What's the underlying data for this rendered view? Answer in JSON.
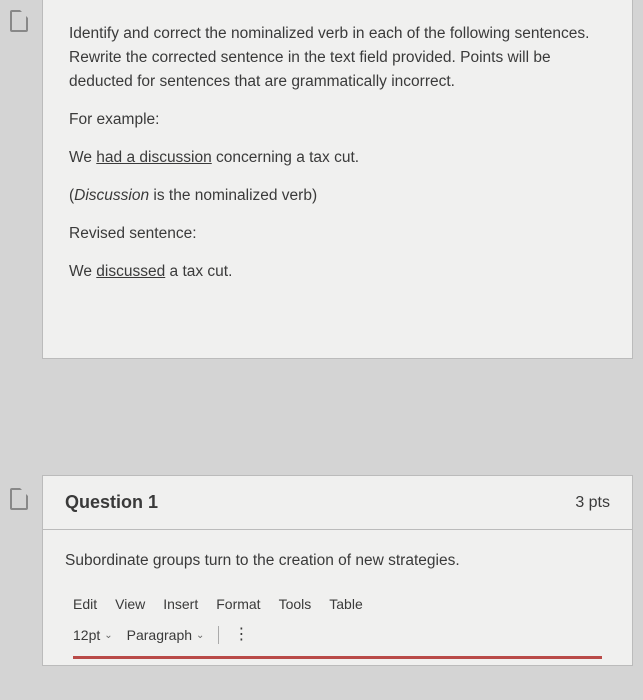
{
  "instructions": {
    "p1": "Identify and correct the nominalized verb in each of the following sentences. Rewrite the corrected sentence in the text field provided. Points will be deducted for sentences that are grammatically incorrect.",
    "for_example": "For example:",
    "ex_pre": "We ",
    "ex_underlined": "had a discussion",
    "ex_post": " concerning a tax cut.",
    "note_open": "(",
    "note_italic": "Discussion",
    "note_rest": " is the nominalized verb)",
    "revised_label": "Revised sentence:",
    "rev_pre": "We ",
    "rev_underlined": "discussed",
    "rev_post": " a tax cut."
  },
  "question": {
    "title": "Question 1",
    "points": "3 pts",
    "prompt": "Subordinate groups turn to the creation of new strategies."
  },
  "editor": {
    "menu": {
      "edit": "Edit",
      "view": "View",
      "insert": "Insert",
      "format": "Format",
      "tools": "Tools",
      "table": "Table"
    },
    "toolbar": {
      "fontsize": "12pt",
      "style": "Paragraph"
    }
  }
}
